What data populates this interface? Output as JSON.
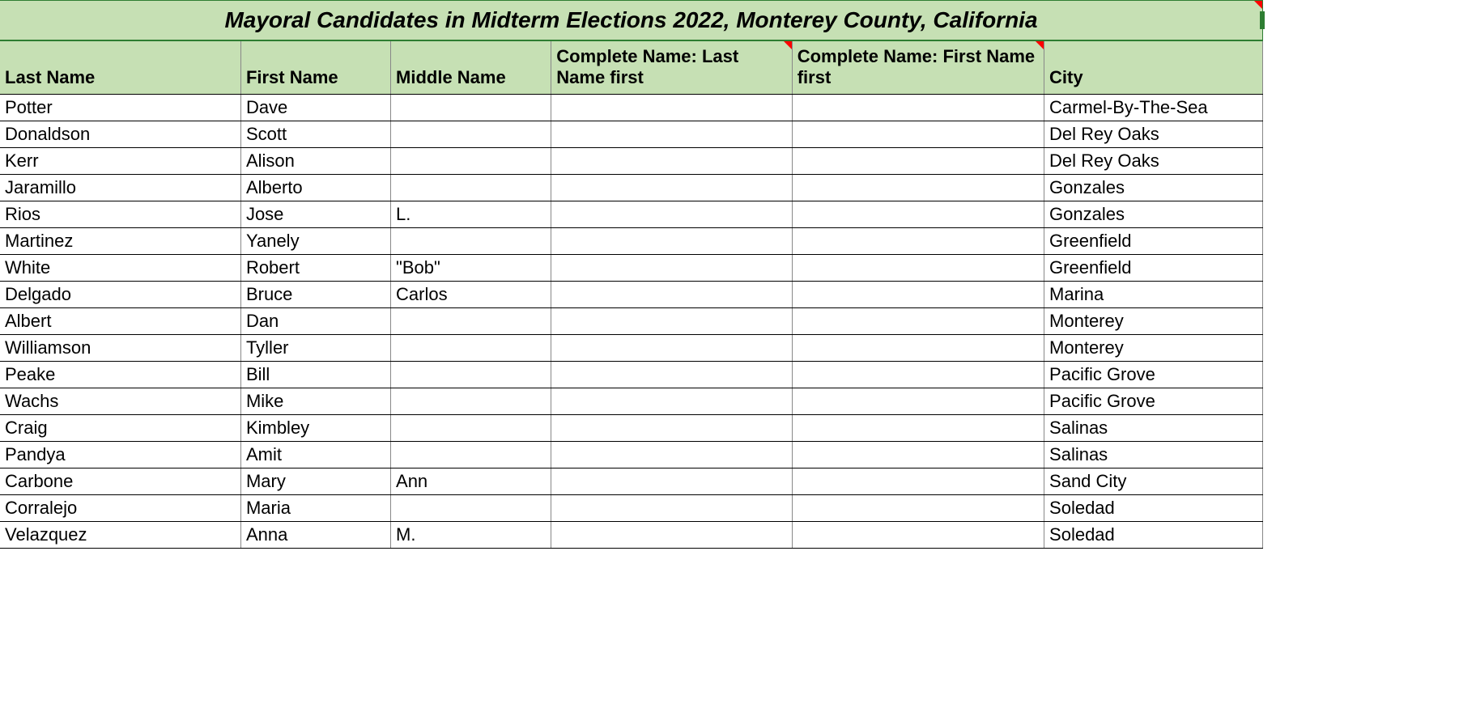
{
  "title": "Mayoral Candidates in Midterm Elections 2022, Monterey County, California",
  "headers": {
    "last_name": "Last Name",
    "first_name": "First Name",
    "middle_name": "Middle Name",
    "complete_last_first": "Complete Name: Last Name first",
    "complete_first_first": "Complete Name: First Name first",
    "city": "City"
  },
  "rows": [
    {
      "last": "Potter",
      "first": "Dave",
      "middle": "",
      "cln": "",
      "cfn": "",
      "city": "Carmel-By-The-Sea"
    },
    {
      "last": "Donaldson",
      "first": "Scott",
      "middle": "",
      "cln": "",
      "cfn": "",
      "city": "Del Rey Oaks"
    },
    {
      "last": "Kerr",
      "first": "Alison",
      "middle": "",
      "cln": "",
      "cfn": "",
      "city": "Del Rey Oaks"
    },
    {
      "last": "Jaramillo",
      "first": "Alberto",
      "middle": "",
      "cln": "",
      "cfn": "",
      "city": "Gonzales"
    },
    {
      "last": "Rios",
      "first": "Jose",
      "middle": "L.",
      "cln": "",
      "cfn": "",
      "city": "Gonzales"
    },
    {
      "last": "Martinez",
      "first": "Yanely",
      "middle": "",
      "cln": "",
      "cfn": "",
      "city": "Greenfield"
    },
    {
      "last": "White",
      "first": "Robert",
      "middle": "\"Bob\"",
      "cln": "",
      "cfn": "",
      "city": "Greenfield"
    },
    {
      "last": "Delgado",
      "first": "Bruce",
      "middle": "Carlos",
      "cln": "",
      "cfn": "",
      "city": "Marina"
    },
    {
      "last": "Albert",
      "first": "Dan",
      "middle": "",
      "cln": "",
      "cfn": "",
      "city": "Monterey"
    },
    {
      "last": "Williamson",
      "first": "Tyller",
      "middle": "",
      "cln": "",
      "cfn": "",
      "city": "Monterey"
    },
    {
      "last": "Peake",
      "first": "Bill",
      "middle": "",
      "cln": "",
      "cfn": "",
      "city": "Pacific Grove"
    },
    {
      "last": "Wachs",
      "first": "Mike",
      "middle": "",
      "cln": "",
      "cfn": "",
      "city": "Pacific Grove"
    },
    {
      "last": "Craig",
      "first": "Kimbley",
      "middle": "",
      "cln": "",
      "cfn": "",
      "city": "Salinas"
    },
    {
      "last": "Pandya",
      "first": "Amit",
      "middle": "",
      "cln": "",
      "cfn": "",
      "city": "Salinas"
    },
    {
      "last": "Carbone",
      "first": "Mary",
      "middle": "Ann",
      "cln": "",
      "cfn": "",
      "city": "Sand City"
    },
    {
      "last": "Corralejo",
      "first": "Maria",
      "middle": "",
      "cln": "",
      "cfn": "",
      "city": "Soledad"
    },
    {
      "last": "Velazquez",
      "first": "Anna",
      "middle": "M.",
      "cln": "",
      "cfn": "",
      "city": "Soledad"
    }
  ]
}
